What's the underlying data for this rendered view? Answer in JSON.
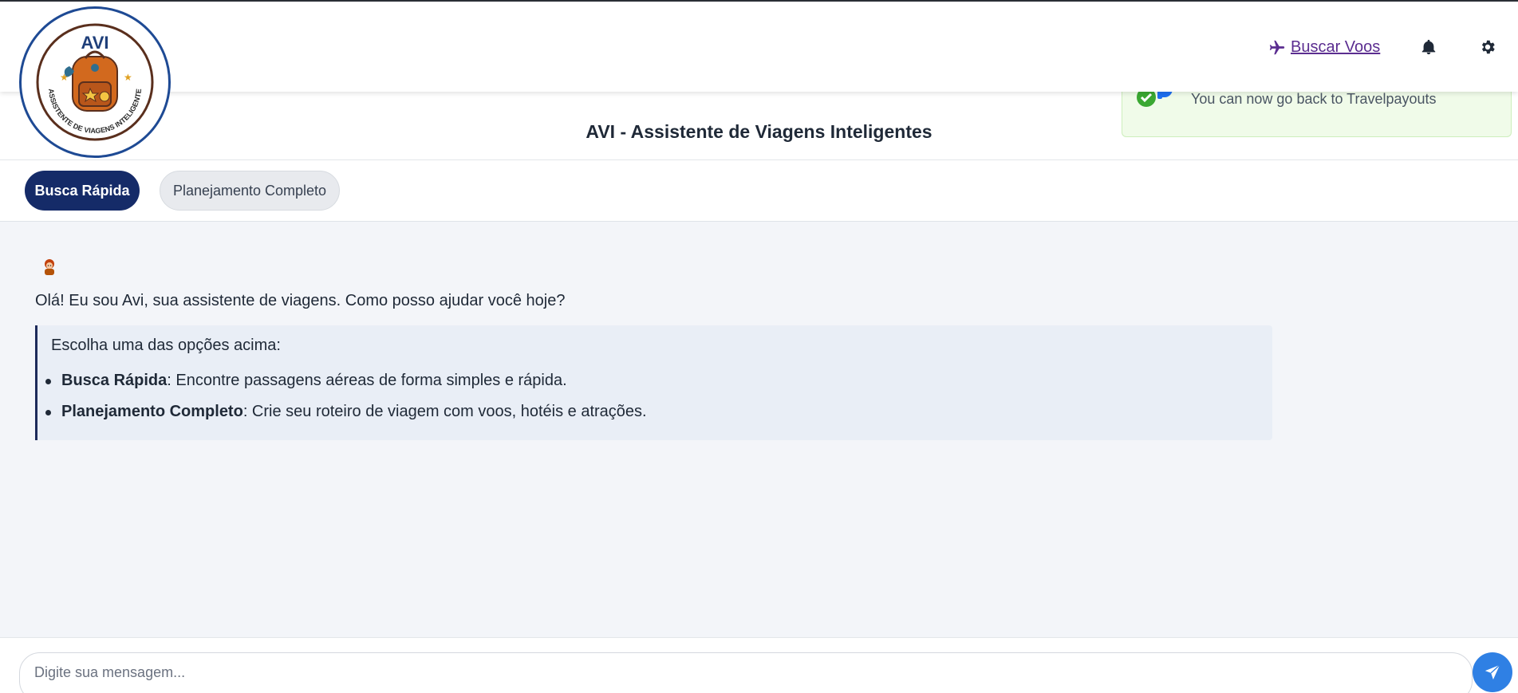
{
  "app": {
    "title": "AVI - Assistente de Viagens Inteligentes",
    "logo_text": "AVI",
    "logo_subtitle": "ASSISTENTE DE VIAGENS INTELIGENTE"
  },
  "navbar": {
    "search_flights_label": "Buscar Voos",
    "icons": [
      "airplane-icon",
      "bell-icon",
      "gear-icon"
    ]
  },
  "toast": {
    "message": "You can now go back to Travelpayouts",
    "icons": [
      "check-circle-icon",
      "travelpayouts-logo"
    ]
  },
  "tabs": [
    {
      "label": "Busca Rápida",
      "active": true
    },
    {
      "label": "Planejamento Completo",
      "active": false
    }
  ],
  "chat": {
    "greeting": "Olá! Eu sou Avi, sua assistente de viagens. Como posso ajudar você hoje?",
    "intro": "Escolha uma das opções acima:",
    "options": [
      {
        "title": "Busca Rápida",
        "desc": ": Encontre passagens aéreas de forma simples e rápida."
      },
      {
        "title": "Planejamento Completo",
        "desc": ": Crie seu roteiro de viagem com voos, hotéis e atrações."
      }
    ]
  },
  "input": {
    "placeholder": "Digite sua mensagem...",
    "value": ""
  },
  "colors": {
    "primary_dark": "#152b68",
    "link_purple": "#5b2d90",
    "send_blue": "#2f80e4",
    "toast_bg": "#f0fbe9",
    "chat_bg": "#f3f5f9",
    "info_bg": "#e9eef6"
  }
}
